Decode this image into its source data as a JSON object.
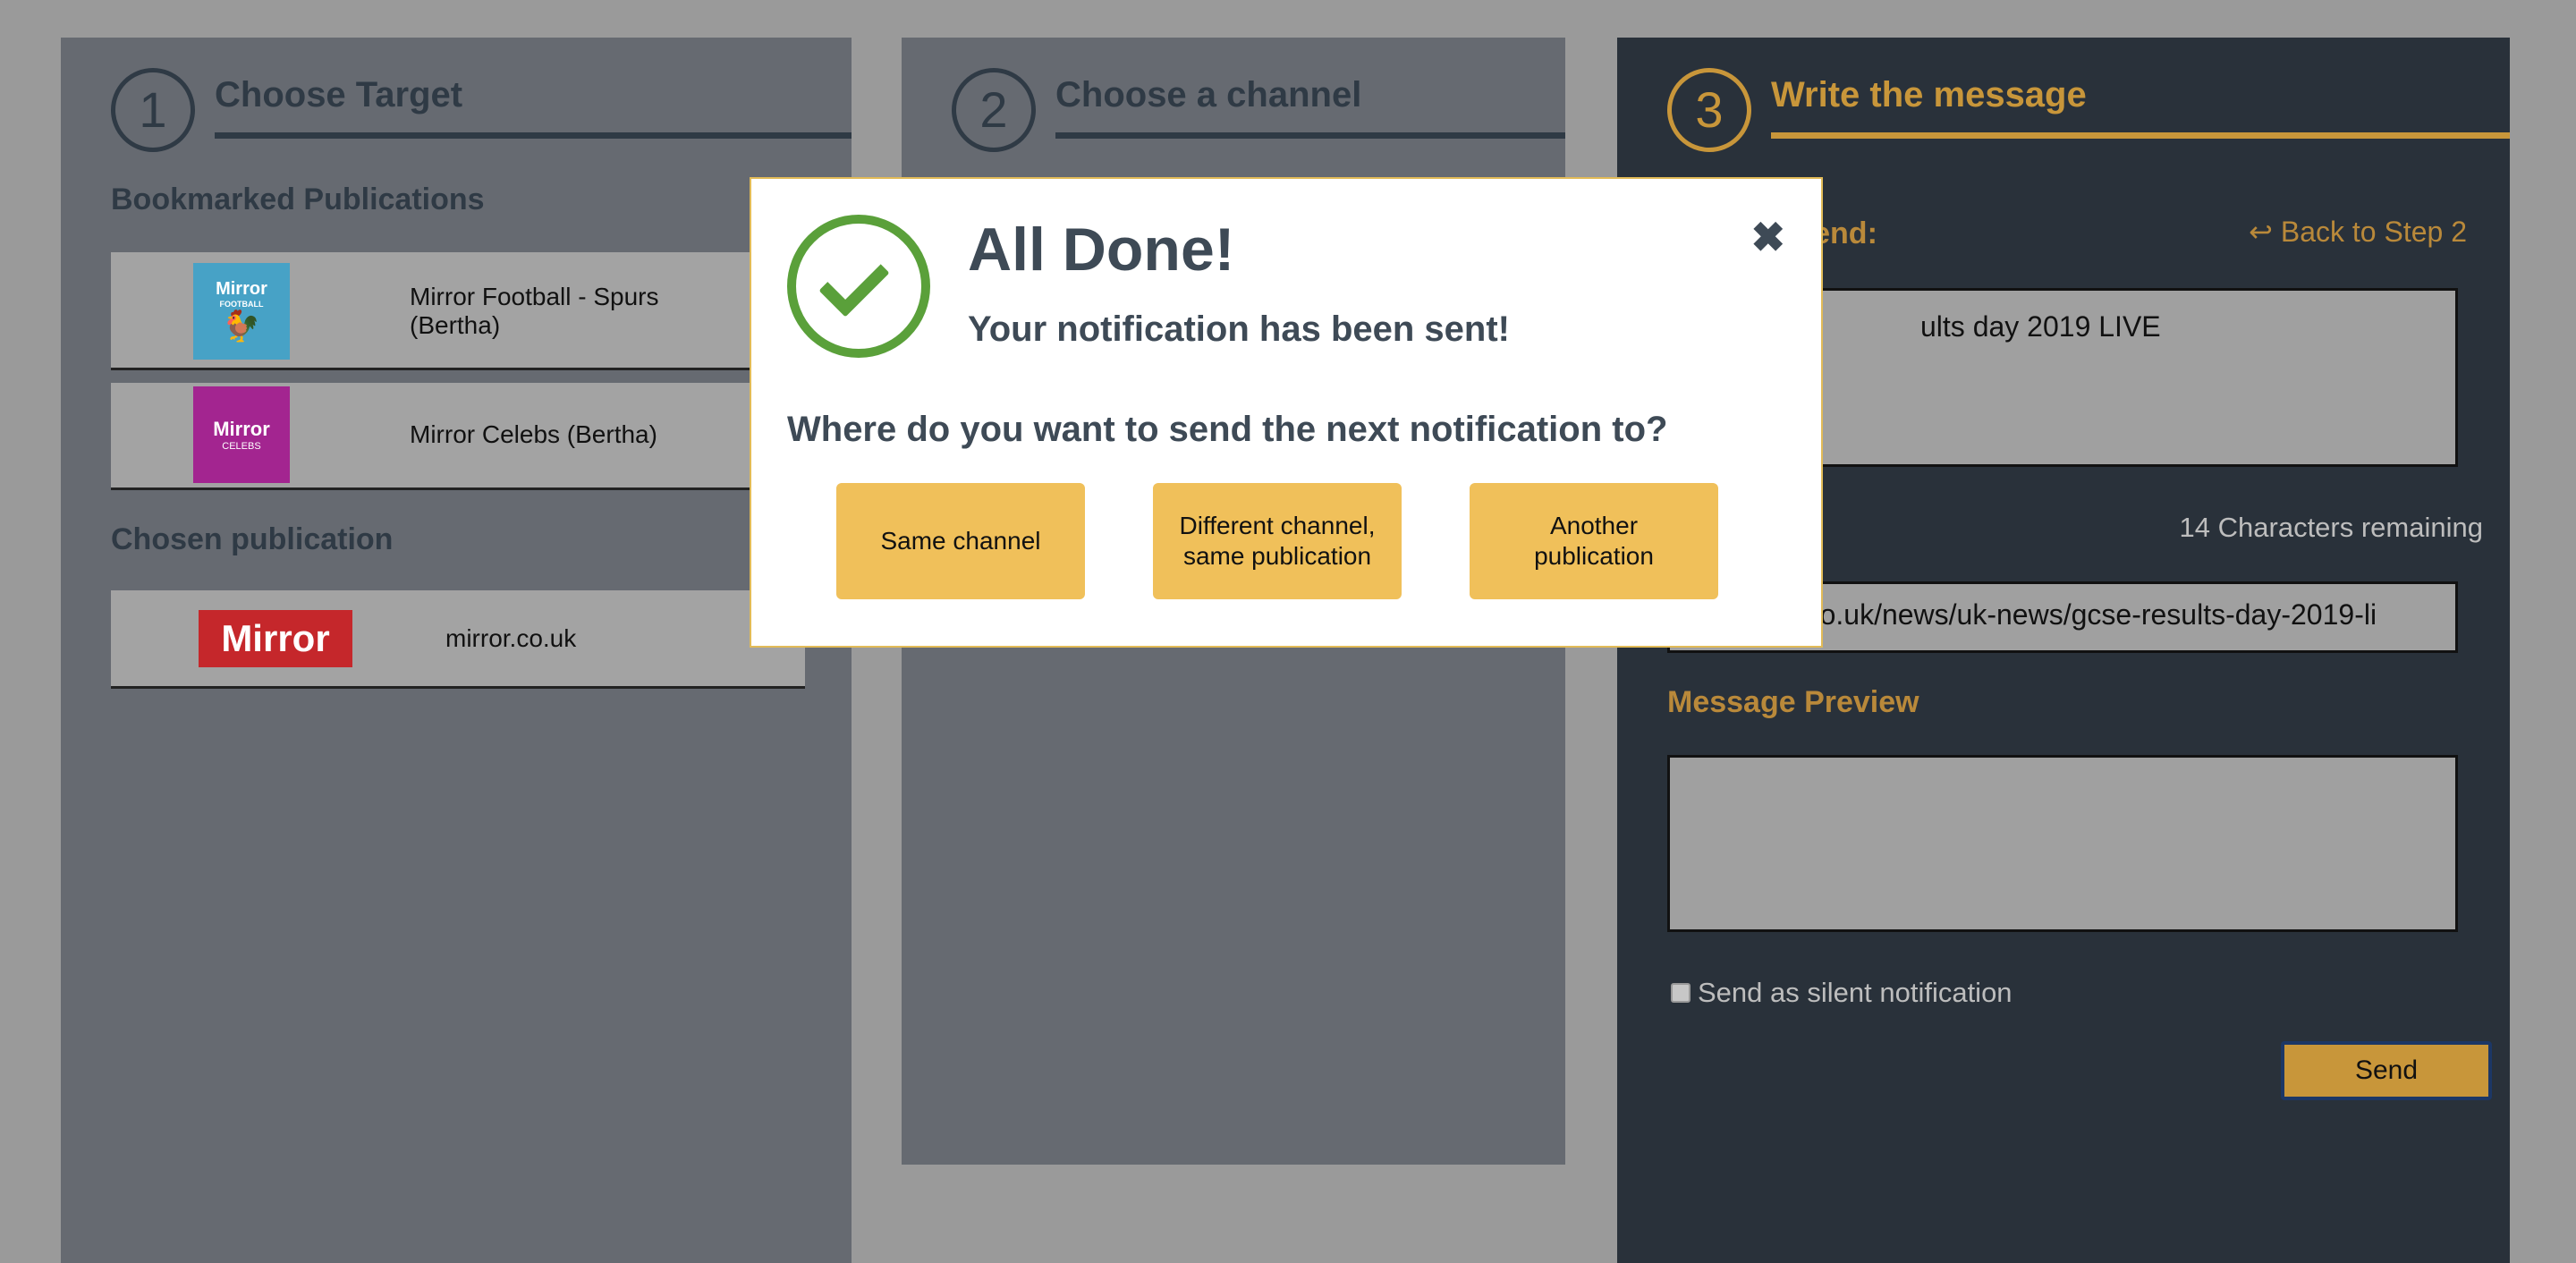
{
  "step1": {
    "number": "1",
    "title": "Choose Target",
    "bookmarked_heading": "Bookmarked Publications",
    "bookmarked": [
      {
        "name": "Mirror Football - Spurs (Bertha)",
        "logo_top": "Mirror",
        "logo_sub": "FOOTBALL",
        "logo_color": "#47a2c6"
      },
      {
        "name": "Mirror Celebs (Bertha)",
        "logo_top": "Mirror",
        "logo_sub": "CELEBS",
        "logo_color": "#a32590"
      }
    ],
    "chosen_heading": "Chosen publication",
    "chosen": {
      "name": "mirror.co.uk",
      "logo_text": "Mirror",
      "logo_color": "#c5272b"
    }
  },
  "step2": {
    "number": "2",
    "title": "Choose a channel"
  },
  "step3": {
    "number": "3",
    "title": "Write the message",
    "message_label_partial": "o send:",
    "back_link": "Back to Step 2",
    "message_value_partial": "ults day 2019 LIVE",
    "chars_remaining": "14 Characters remaining",
    "url_value_partial": "or.co.uk/news/uk-news/gcse-results-day-2019-li",
    "preview_label": "Message Preview",
    "silent_label": "Send as silent notification",
    "send_label": "Send"
  },
  "modal": {
    "title": "All Done!",
    "subtitle": "Your notification has been sent!",
    "question": "Where do you want to send the next notification to?",
    "close_glyph": "✖",
    "choices": [
      "Same channel",
      "Different channel, same publication",
      "Another publication"
    ]
  },
  "colors": {
    "accent_gold": "#c8963a",
    "success_green": "#5aa03a",
    "button_yellow": "#f0c05a"
  }
}
